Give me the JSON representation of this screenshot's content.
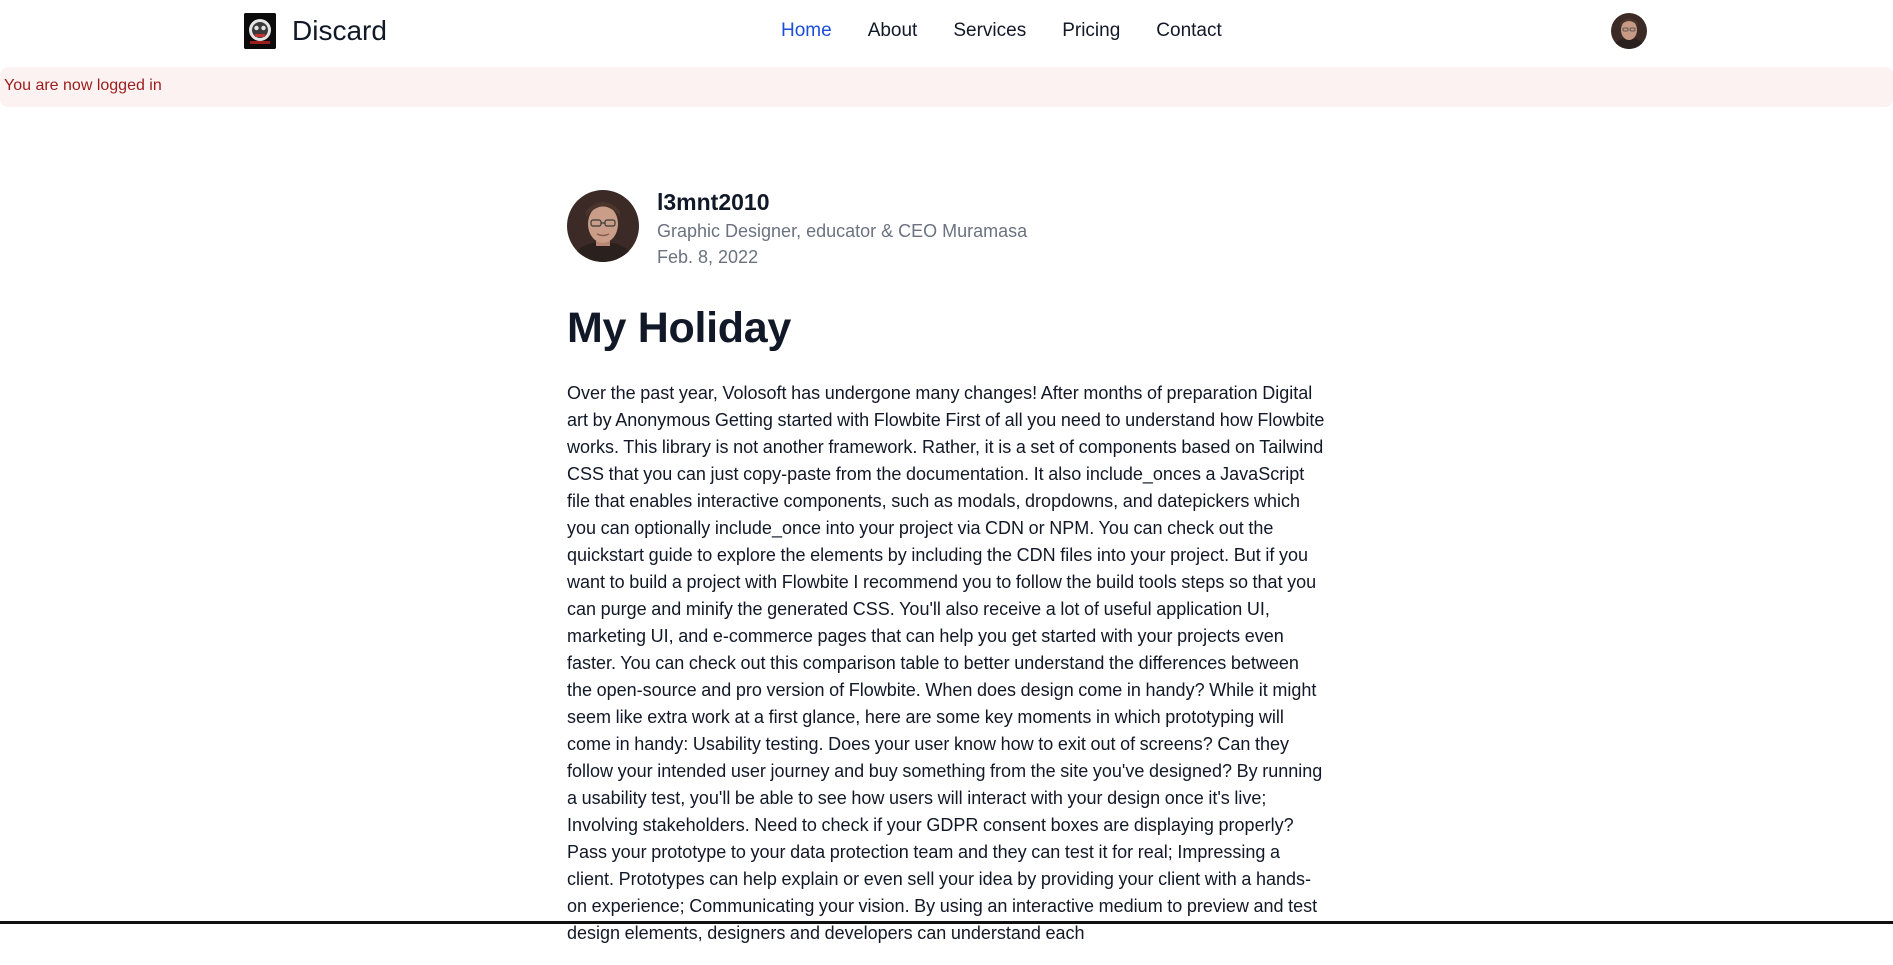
{
  "nav": {
    "brand": "Discard",
    "links": [
      "Home",
      "About",
      "Services",
      "Pricing",
      "Contact"
    ],
    "active": "Home"
  },
  "alert": {
    "message": "You are now logged in"
  },
  "author": {
    "username": "l3mnt2010",
    "bio": "Graphic Designer, educator & CEO Muramasa",
    "date": "Feb. 8, 2022"
  },
  "post": {
    "title": "My Holiday",
    "body": "Over the past year, Volosoft has undergone many changes! After months of preparation Digital art by Anonymous Getting started with Flowbite First of all you need to understand how Flowbite works. This library is not another framework. Rather, it is a set of components based on Tailwind CSS that you can just copy-paste from the documentation. It also include_onces a JavaScript file that enables interactive components, such as modals, dropdowns, and datepickers which you can optionally include_once into your project via CDN or NPM. You can check out the quickstart guide to explore the elements by including the CDN files into your project. But if you want to build a project with Flowbite I recommend you to follow the build tools steps so that you can purge and minify the generated CSS. You'll also receive a lot of useful application UI, marketing UI, and e-commerce pages that can help you get started with your projects even faster. You can check out this comparison table to better understand the differences between the open-source and pro version of Flowbite. When does design come in handy? While it might seem like extra work at a first glance, here are some key moments in which prototyping will come in handy: Usability testing. Does your user know how to exit out of screens? Can they follow your intended user journey and buy something from the site you've designed? By running a usability test, you'll be able to see how users will interact with your design once it's live; Involving stakeholders. Need to check if your GDPR consent boxes are displaying properly? Pass your prototype to your data protection team and they can test it for real; Impressing a client. Prototypes can help explain or even sell your idea by providing your client with a hands-on experience; Communicating your vision. By using an interactive medium to preview and test design elements, designers and developers can understand each"
  },
  "colors": {
    "accent": "#1d4ed8",
    "alert_bg": "#fdf2f2",
    "alert_text": "#9b1c1c",
    "muted": "#6b7280"
  }
}
